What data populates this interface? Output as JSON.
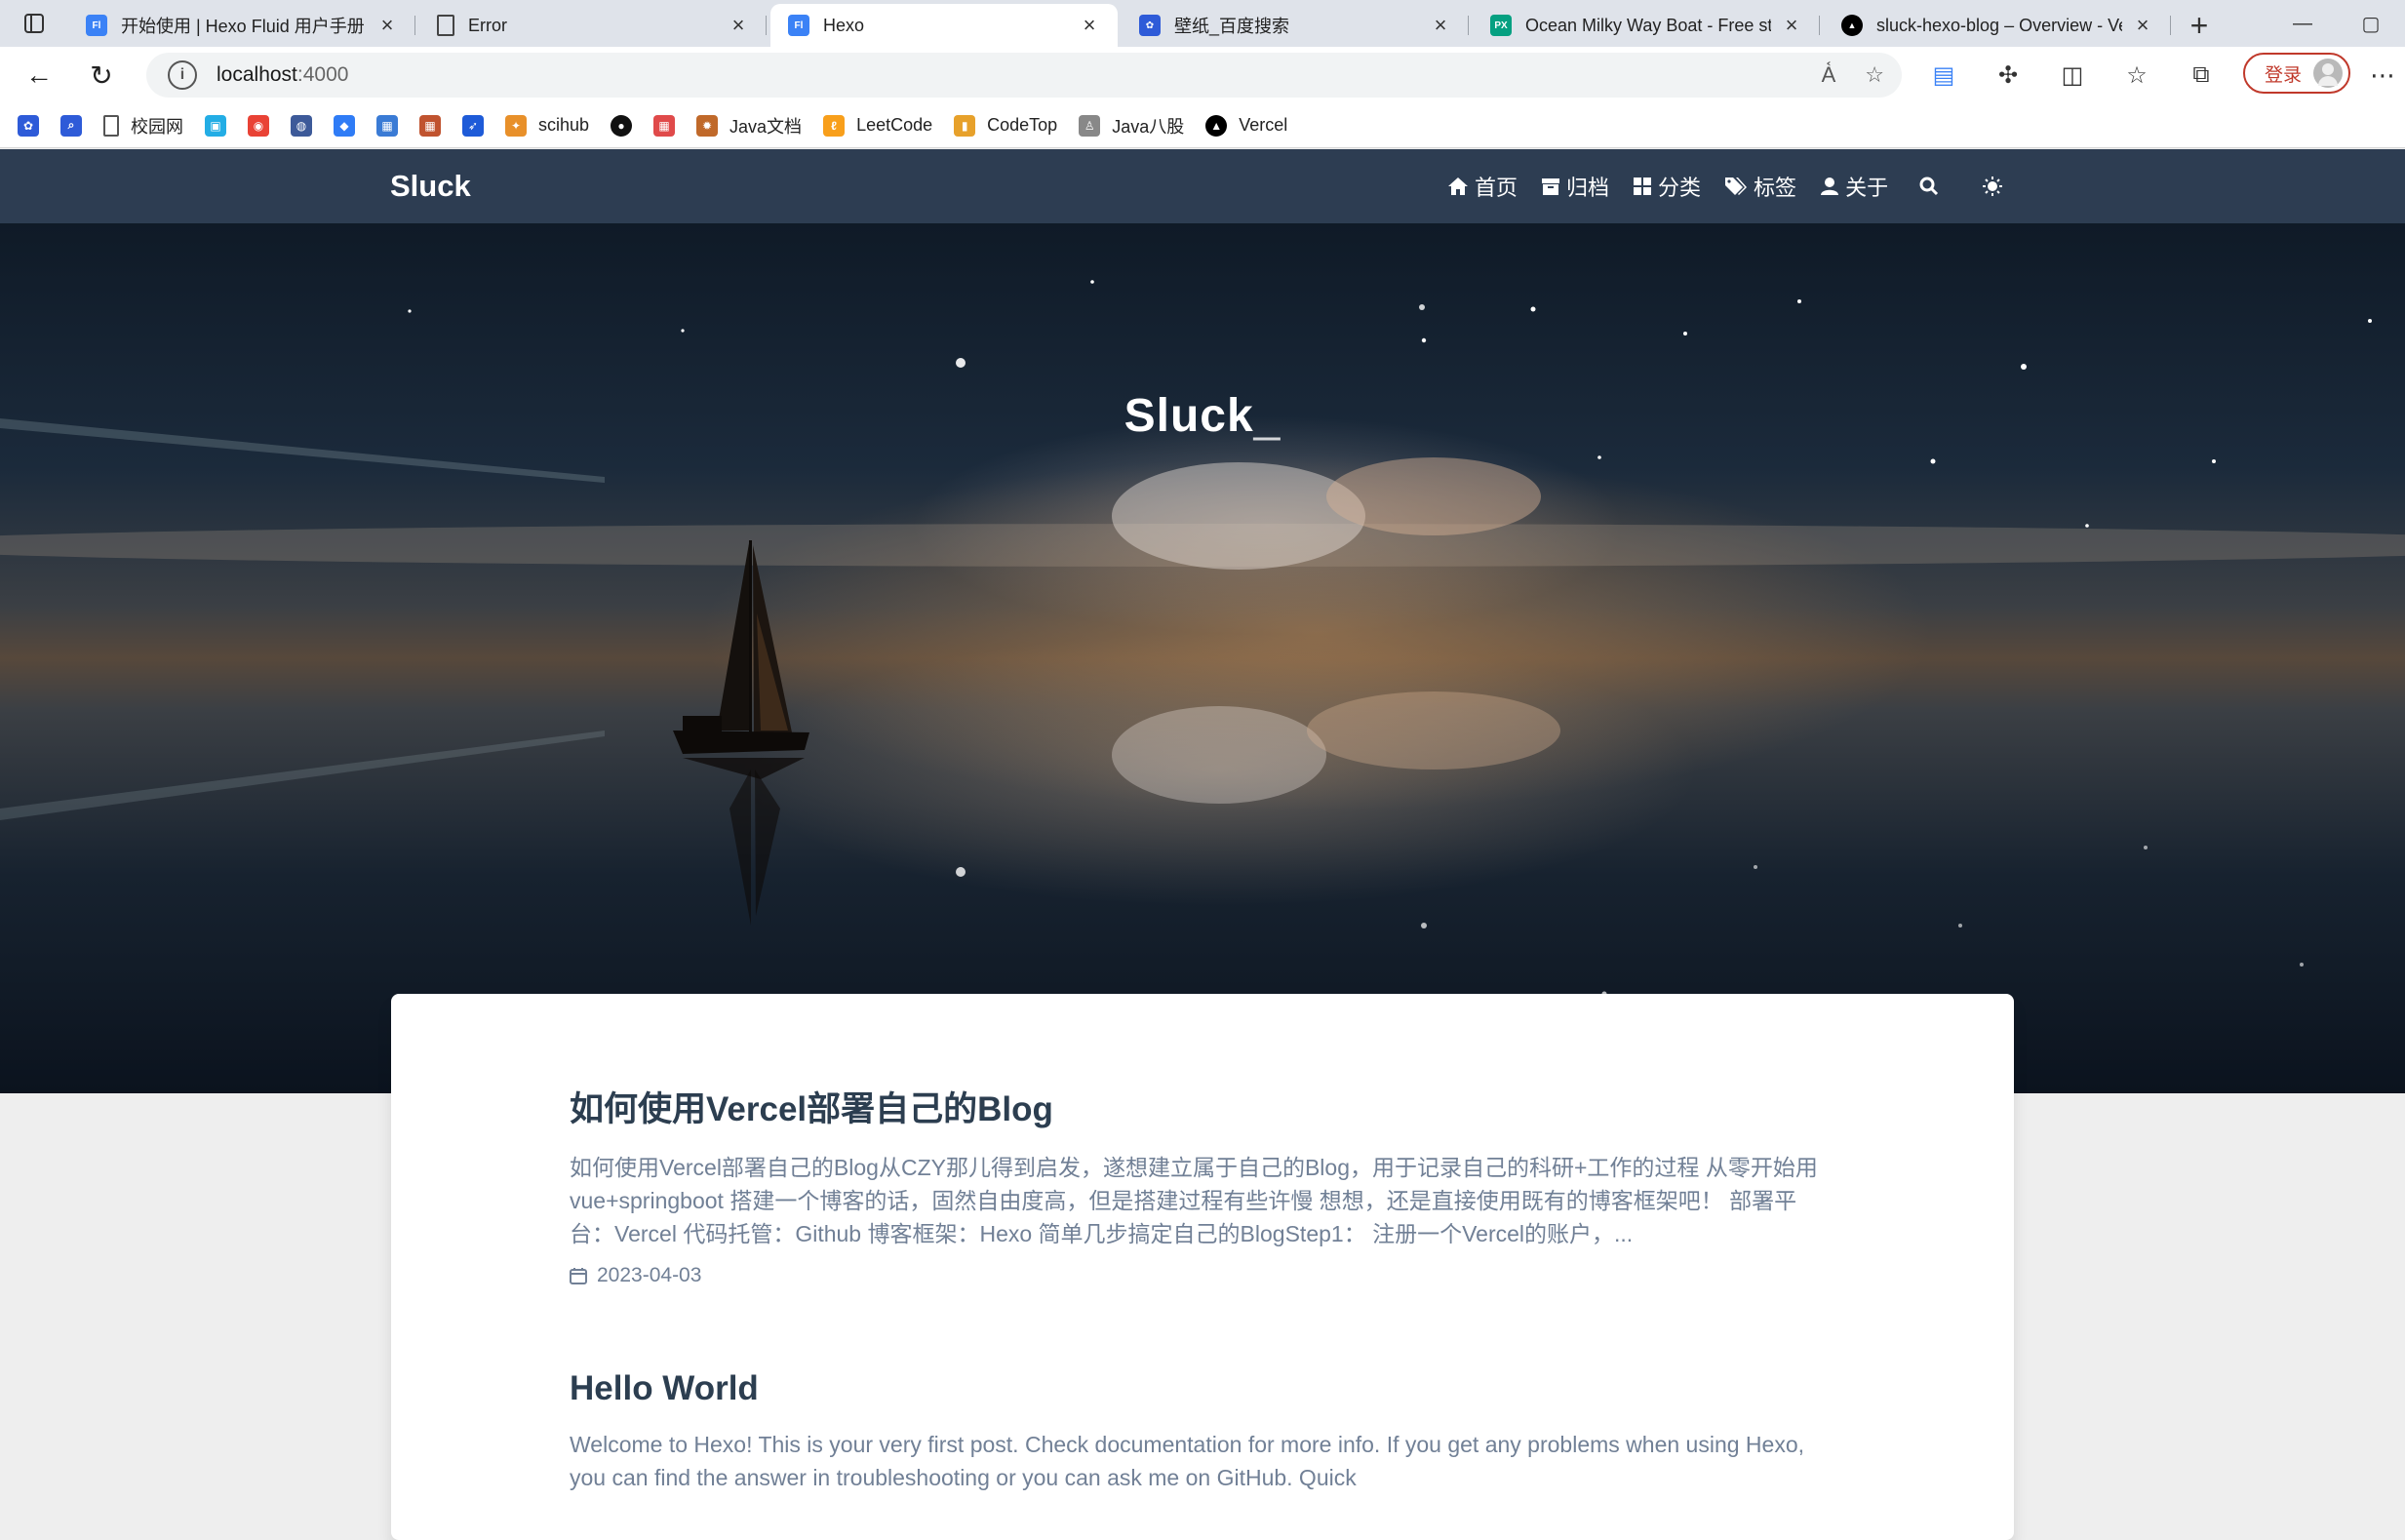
{
  "browser": {
    "tabs": [
      {
        "title": "开始使用 | Hexo Fluid 用户手册",
        "favicon": "fluid-icon",
        "color": "#3b82f6",
        "active": false
      },
      {
        "title": "Error",
        "favicon": "page-icon",
        "color": "#ffffff",
        "active": false
      },
      {
        "title": "Hexo",
        "favicon": "fluid-icon",
        "color": "#3b82f6",
        "active": true
      },
      {
        "title": "壁纸_百度搜索",
        "favicon": "baidu-paw-icon",
        "color": "#2e5bd8",
        "active": false
      },
      {
        "title": "Ocean Milky Way Boat - Free sto",
        "favicon": "pexels-icon",
        "color": "#05a081",
        "active": false
      },
      {
        "title": "sluck-hexo-blog – Overview - Ve",
        "favicon": "vercel-icon",
        "color": "#000000",
        "active": false
      }
    ],
    "url_host": "localhost",
    "url_port": ":4000",
    "login_label": "登录"
  },
  "bookmarks": [
    {
      "label": "",
      "icon": "baidu-paw-icon",
      "color": "#2e5bd8"
    },
    {
      "label": "",
      "icon": "search-icon",
      "color": "#2e5bd8"
    },
    {
      "label": "校园网",
      "icon": "page-icon",
      "color": "#555555"
    },
    {
      "label": "",
      "icon": "bilibili-icon",
      "color": "#23ade5"
    },
    {
      "label": "",
      "icon": "chrome-icon",
      "color": "#e94235"
    },
    {
      "label": "",
      "icon": "globe-icon",
      "color": "#3d5a99"
    },
    {
      "label": "",
      "icon": "diamond-icon",
      "color": "#2f7cf6"
    },
    {
      "label": "",
      "icon": "app-icon",
      "color": "#3a7bd5"
    },
    {
      "label": "",
      "icon": "app-icon",
      "color": "#c0532f"
    },
    {
      "label": "",
      "icon": "bird-icon",
      "color": "#1e5bd8"
    },
    {
      "label": "scihub",
      "icon": "scihub-icon",
      "color": "#e8902a"
    },
    {
      "label": "",
      "icon": "github-icon",
      "color": "#111111"
    },
    {
      "label": "",
      "icon": "app-icon",
      "color": "#e04a4a"
    },
    {
      "label": "Java文档",
      "icon": "java-icon",
      "color": "#c0692a"
    },
    {
      "label": "LeetCode",
      "icon": "leetcode-icon",
      "color": "#f89f1b"
    },
    {
      "label": "CodeTop",
      "icon": "chart-icon",
      "color": "#e7a12b"
    },
    {
      "label": "Java八股",
      "icon": "person-icon",
      "color": "#888888"
    },
    {
      "label": "Vercel",
      "icon": "vercel-icon",
      "color": "#000000"
    }
  ],
  "site": {
    "brand": "Sluck",
    "menu": [
      {
        "label": "首页",
        "icon": "home-icon"
      },
      {
        "label": "归档",
        "icon": "archive-icon"
      },
      {
        "label": "分类",
        "icon": "grid-icon"
      },
      {
        "label": "标签",
        "icon": "tags-icon"
      },
      {
        "label": "关于",
        "icon": "user-icon"
      }
    ],
    "banner_title": "Sluck",
    "banner_cursor": "_"
  },
  "posts": [
    {
      "title": "如何使用Vercel部署自己的Blog",
      "excerpt": "如何使用Vercel部署自己的Blog从CZY那儿得到启发，遂想建立属于自己的Blog，用于记录自己的科研+工作的过程 从零开始用vue+springboot 搭建一个博客的话，固然自由度高，但是搭建过程有些许慢 想想，还是直接使用既有的博客框架吧！ 部署平台：Vercel 代码托管：Github 博客框架：Hexo 简单几步搞定自己的BlogStep1： 注册一个Vercel的账户，...",
      "date": "2023-04-03"
    },
    {
      "title": "Hello World",
      "excerpt": "Welcome to Hexo! This is your very first post. Check documentation for more info. If you get any problems when using Hexo, you can find the answer in troubleshooting or you can ask me on GitHub. Quick",
      "date": ""
    }
  ]
}
